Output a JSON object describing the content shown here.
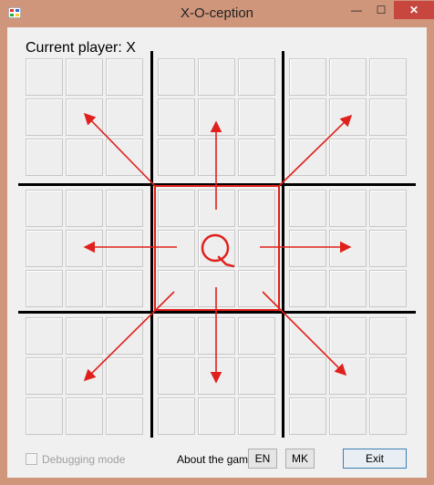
{
  "window": {
    "title": "X-O-ception",
    "min_glyph": "—",
    "max_glyph": "☐",
    "close_glyph": "✕"
  },
  "status": {
    "current_player": "Current player: X"
  },
  "board": {
    "large_grid": 3,
    "small_grid": 3,
    "active_board": "center",
    "center_mark": "O"
  },
  "footer": {
    "debug_label": "Debugging mode",
    "debug_checked": false,
    "about_label": "About the game",
    "lang_en": "EN",
    "lang_mk": "MK",
    "exit_label": "Exit"
  },
  "colors": {
    "active": "#e0201c",
    "grid": "#000000",
    "close": "#c7463d"
  }
}
